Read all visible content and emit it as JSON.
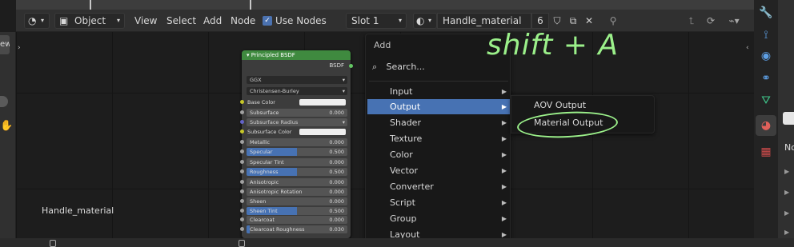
{
  "header": {
    "editor_type_icon": "shader-editor-icon",
    "mode_select": "Object",
    "menus": [
      "View",
      "Select",
      "Add",
      "Node"
    ],
    "use_nodes_label": "Use Nodes",
    "slot_select": "Slot 1",
    "material_name": "Handle_material",
    "user_count": "6"
  },
  "node": {
    "title": "Principled BSDF",
    "output_label": "BSDF",
    "distribution": "GGX",
    "subsurface_method": "Christensen-Burley",
    "base_color_label": "Base Color",
    "subsurface_radius_label": "Subsurface Radius",
    "subsurface_color_label": "Subsurface Color",
    "fields": [
      {
        "label": "Subsurface",
        "value": "0.000",
        "fill": 0
      },
      {
        "label": "Metallic",
        "value": "0.000",
        "fill": 0
      },
      {
        "label": "Specular",
        "value": "0.500",
        "fill": 0.5
      },
      {
        "label": "Specular Tint",
        "value": "0.000",
        "fill": 0
      },
      {
        "label": "Roughness",
        "value": "0.500",
        "fill": 0.5
      },
      {
        "label": "Anisotropic",
        "value": "0.000",
        "fill": 0
      },
      {
        "label": "Anisotropic Rotation",
        "value": "0.000",
        "fill": 0
      },
      {
        "label": "Sheen",
        "value": "0.000",
        "fill": 0
      },
      {
        "label": "Sheen Tint",
        "value": "0.500",
        "fill": 0.5
      },
      {
        "label": "Clearcoat",
        "value": "0.000",
        "fill": 0
      },
      {
        "label": "Clearcoat Roughness",
        "value": "0.030",
        "fill": 0.03
      }
    ]
  },
  "add_menu": {
    "title": "Add",
    "search": "Search...",
    "items": [
      {
        "label": "Input",
        "active": false
      },
      {
        "label": "Output",
        "active": true
      },
      {
        "label": "Shader",
        "active": false
      },
      {
        "label": "Texture",
        "active": false
      },
      {
        "label": "Color",
        "active": false
      },
      {
        "label": "Vector",
        "active": false
      },
      {
        "label": "Converter",
        "active": false
      },
      {
        "label": "Script",
        "active": false
      },
      {
        "label": "Group",
        "active": false
      },
      {
        "label": "Layout",
        "active": false
      }
    ]
  },
  "output_submenu": {
    "items": [
      "AOV Output",
      "Material Output"
    ]
  },
  "annotation": "shift + A",
  "frame_label": "Handle_material",
  "left_tab_label": "ew",
  "props_label": "No",
  "colors": {
    "accent": "#4772b3",
    "node_header": "#3f8a3f",
    "annotation": "#9bf08a"
  }
}
